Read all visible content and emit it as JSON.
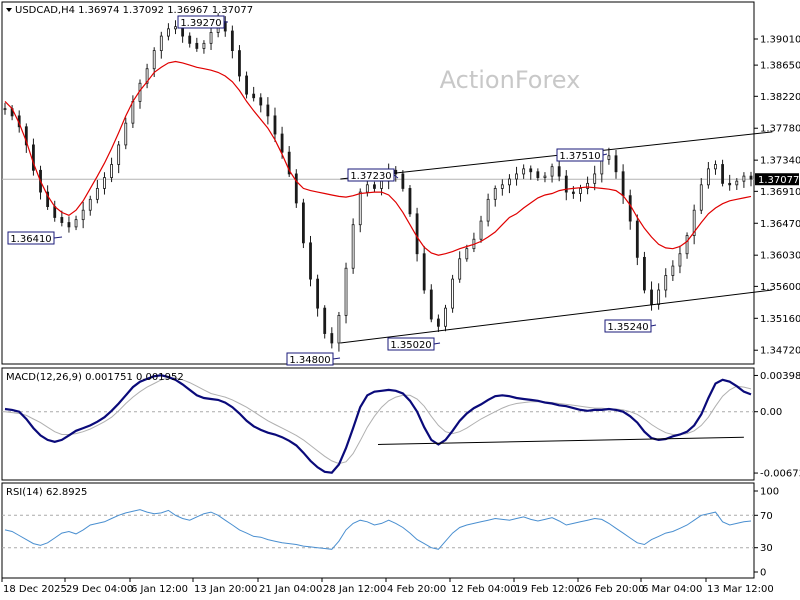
{
  "watermark": "ActionForex",
  "colors": {
    "price": "#1a1a1a",
    "ma": "#e00000",
    "macd": "#0a0a7a",
    "signal": "#b0b0b0",
    "rsi": "#4a8fd0",
    "trend": "#000000",
    "label_border": "#1a1a7a",
    "current_bg": "#000000"
  },
  "chart_data": [
    {
      "type": "line",
      "panel": "price",
      "title": "USDCAD,H4  1.36974 1.37092 1.36967 1.37077",
      "yticks": [
        "1.39010",
        "1.38650",
        "1.38220",
        "1.37780",
        "1.37340",
        "1.36910",
        "1.36470",
        "1.36030",
        "1.35600",
        "1.35160",
        "1.34720"
      ],
      "ylim": [
        1.3453,
        1.3952
      ],
      "current_price": "1.37077",
      "callouts": [
        "1.36410",
        "1.39270",
        "1.37230",
        "1.37510",
        "1.34800",
        "1.35020",
        "1.35240"
      ],
      "series": [
        {
          "values": [
            1.3805,
            1.3795,
            1.378,
            1.3755,
            1.372,
            1.369,
            1.367,
            1.3655,
            1.3648,
            1.3642,
            1.3652,
            1.3665,
            1.368,
            1.3695,
            1.371,
            1.3728,
            1.3755,
            1.3785,
            1.3815,
            1.384,
            1.386,
            1.3885,
            1.3905,
            1.3915,
            1.3918,
            1.3905,
            1.3895,
            1.3888,
            1.3895,
            1.391,
            1.3925,
            1.3912,
            1.3885,
            1.385,
            1.3825,
            1.382,
            1.381,
            1.3795,
            1.377,
            1.3745,
            1.3715,
            1.3675,
            1.362,
            1.357,
            1.353,
            1.3495,
            1.3482,
            1.352,
            1.3585,
            1.3645,
            1.369,
            1.37,
            1.3695,
            1.3705,
            1.372,
            1.3715,
            1.3695,
            1.366,
            1.3605,
            1.3555,
            1.3515,
            1.3505,
            1.353,
            1.357,
            1.3598,
            1.3612,
            1.3625,
            1.365,
            1.368,
            1.3695,
            1.37,
            1.3708,
            1.3715,
            1.3722,
            1.3718,
            1.371,
            1.3712,
            1.3725,
            1.3712,
            1.369,
            1.3688,
            1.3695,
            1.3702,
            1.3715,
            1.3735,
            1.374,
            1.3718,
            1.3685,
            1.365,
            1.36,
            1.3555,
            1.3535,
            1.3555,
            1.3575,
            1.3588,
            1.3605,
            1.363,
            1.3665,
            1.37,
            1.3722,
            1.3728,
            1.3702,
            1.37,
            1.3705,
            1.3712,
            1.3708
          ]
        },
        {
          "values": [
            1.3815,
            1.3805,
            1.3785,
            1.376,
            1.373,
            1.3705,
            1.3685,
            1.367,
            1.3662,
            1.3658,
            1.3665,
            1.3678,
            1.3695,
            1.3712,
            1.373,
            1.375,
            1.3772,
            1.3795,
            1.3815,
            1.383,
            1.3842,
            1.3855,
            1.3862,
            1.3868,
            1.387,
            1.3868,
            1.3865,
            1.3862,
            1.386,
            1.3858,
            1.3855,
            1.385,
            1.3842,
            1.383,
            1.3815,
            1.3802,
            1.379,
            1.3778,
            1.3762,
            1.3742,
            1.372,
            1.3705,
            1.3695,
            1.3692,
            1.369,
            1.3688,
            1.3686,
            1.3684,
            1.3683,
            1.3685,
            1.3688,
            1.3689,
            1.369,
            1.369,
            1.3686,
            1.3676,
            1.3662,
            1.3645,
            1.3628,
            1.3614,
            1.3606,
            1.3603,
            1.3605,
            1.3608,
            1.3612,
            1.3615,
            1.3618,
            1.3622,
            1.3628,
            1.3635,
            1.3645,
            1.3655,
            1.366,
            1.3668,
            1.3675,
            1.3682,
            1.3686,
            1.3688,
            1.3692,
            1.3694,
            1.3695,
            1.3696,
            1.3697,
            1.3696,
            1.3695,
            1.3694,
            1.3692,
            1.3685,
            1.3672,
            1.3655,
            1.364,
            1.3628,
            1.3618,
            1.3613,
            1.3612,
            1.3615,
            1.3622,
            1.3635,
            1.3648,
            1.366,
            1.3668,
            1.3674,
            1.3678,
            1.368,
            1.3682,
            1.3684
          ]
        }
      ],
      "trendlines": [
        {
          "from": [
            47.2,
            1.3708
          ],
          "to": [
            108,
            1.3773
          ]
        },
        {
          "from": [
            47.2,
            1.3482
          ],
          "to": [
            108,
            1.3555
          ]
        }
      ]
    },
    {
      "type": "line",
      "panel": "macd",
      "title": "MACD(12,26,9) 0.001751 0.001952",
      "yticks": [
        "0.003982",
        "0.00",
        "-0.006737"
      ],
      "ylim": [
        -0.0075,
        0.0048
      ],
      "series": [
        {
          "values": [
            0.0003,
            0.0002,
            0.0,
            -0.0008,
            -0.0018,
            -0.0026,
            -0.0031,
            -0.0033,
            -0.0031,
            -0.0026,
            -0.0021,
            -0.0018,
            -0.0015,
            -0.0011,
            -0.0006,
            0.0001,
            0.0009,
            0.0018,
            0.0027,
            0.0033,
            0.0036,
            0.0039,
            0.004,
            0.0038,
            0.0035,
            0.003,
            0.0024,
            0.0018,
            0.0015,
            0.0014,
            0.0013,
            0.001,
            0.0005,
            -0.0002,
            -0.001,
            -0.0016,
            -0.002,
            -0.0023,
            -0.0025,
            -0.0028,
            -0.0032,
            -0.0037,
            -0.0045,
            -0.0054,
            -0.0061,
            -0.0066,
            -0.0067,
            -0.0058,
            -0.004,
            -0.0018,
            0.0005,
            0.0018,
            0.0022,
            0.0023,
            0.0024,
            0.0023,
            0.002,
            0.0012,
            0.0,
            -0.0017,
            -0.0031,
            -0.0036,
            -0.0031,
            -0.0021,
            -0.001,
            -0.0002,
            0.0004,
            0.0008,
            0.0013,
            0.0017,
            0.0018,
            0.0017,
            0.0015,
            0.0014,
            0.0013,
            0.0012,
            0.001,
            0.0009,
            0.0007,
            0.0006,
            0.0004,
            0.0002,
            0.0001,
            0.0002,
            0.0002,
            0.0003,
            0.0002,
            0.0,
            -0.0005,
            -0.0012,
            -0.0022,
            -0.0029,
            -0.0031,
            -0.003,
            -0.0027,
            -0.0025,
            -0.0022,
            -0.0015,
            -0.0003,
            0.0015,
            0.0031,
            0.0035,
            0.0033,
            0.0028,
            0.0022,
            0.0019
          ]
        },
        {
          "values": [
            0.0,
            -0.0001,
            -0.0002,
            -0.0004,
            -0.0008,
            -0.0012,
            -0.0017,
            -0.0022,
            -0.0025,
            -0.0025,
            -0.0024,
            -0.0022,
            -0.0019,
            -0.0015,
            -0.0011,
            -0.0006,
            0.0001,
            0.0009,
            0.0016,
            0.0022,
            0.0027,
            0.0031,
            0.0035,
            0.0037,
            0.0037,
            0.0035,
            0.0032,
            0.0028,
            0.0024,
            0.002,
            0.0018,
            0.0016,
            0.0013,
            0.0009,
            0.0005,
            0.0,
            -0.0005,
            -0.001,
            -0.0014,
            -0.0018,
            -0.0022,
            -0.0026,
            -0.0031,
            -0.0037,
            -0.0043,
            -0.0049,
            -0.0054,
            -0.0057,
            -0.0055,
            -0.0046,
            -0.0032,
            -0.0017,
            -0.0005,
            0.0005,
            0.0012,
            0.0016,
            0.0018,
            0.0018,
            0.0014,
            0.0006,
            -0.0005,
            -0.0015,
            -0.0022,
            -0.0024,
            -0.0022,
            -0.0018,
            -0.0013,
            -0.0008,
            -0.0004,
            0.0,
            0.0004,
            0.0007,
            0.0009,
            0.001,
            0.0011,
            0.0011,
            0.0011,
            0.001,
            0.0009,
            0.0008,
            0.0007,
            0.0006,
            0.0005,
            0.0004,
            0.0004,
            0.0003,
            0.0003,
            0.0002,
            0.0,
            -0.0003,
            -0.0008,
            -0.0014,
            -0.0019,
            -0.0023,
            -0.0025,
            -0.0025,
            -0.0024,
            -0.0021,
            -0.0015,
            -0.0006,
            0.0006,
            0.0017,
            0.0024,
            0.0028,
            0.0027,
            0.0025
          ]
        }
      ],
      "trendlines": [
        {
          "from": [
            52.5,
            -0.0036
          ],
          "to": [
            104,
            -0.0028
          ]
        }
      ]
    },
    {
      "type": "line",
      "panel": "rsi",
      "title": "RSI(14) 62.8925",
      "yticks": [
        "100",
        "70",
        "30",
        "0"
      ],
      "ylim": [
        0,
        100
      ],
      "levels": [
        70,
        30
      ],
      "series": [
        {
          "values": [
            52,
            50,
            45,
            40,
            35,
            33,
            36,
            42,
            48,
            50,
            47,
            52,
            58,
            60,
            62,
            66,
            70,
            73,
            75,
            77,
            74,
            72,
            73,
            76,
            70,
            66,
            64,
            68,
            72,
            74,
            70,
            64,
            58,
            52,
            48,
            44,
            43,
            40,
            38,
            36,
            35,
            34,
            32,
            31,
            30,
            29,
            28,
            38,
            52,
            60,
            64,
            62,
            58,
            60,
            64,
            60,
            55,
            48,
            40,
            35,
            30,
            28,
            38,
            48,
            55,
            58,
            60,
            62,
            64,
            66,
            65,
            64,
            66,
            68,
            65,
            63,
            65,
            67,
            63,
            58,
            60,
            62,
            64,
            66,
            65,
            60,
            54,
            48,
            42,
            36,
            34,
            40,
            44,
            48,
            50,
            54,
            58,
            64,
            70,
            72,
            74,
            62,
            58,
            60,
            62,
            63
          ]
        }
      ]
    }
  ],
  "xaxis": {
    "labels": [
      "18 Dec 2025",
      "29 Dec 04:00",
      "6 Jan 12:00",
      "13 Jan 20:00",
      "21 Jan 04:00",
      "28 Jan 12:00",
      "4 Feb 20:00",
      "12 Feb 04:00",
      "19 Feb 12:00",
      "26 Feb 20:00",
      "6 Mar 04:00",
      "13 Mar 12:00"
    ]
  }
}
